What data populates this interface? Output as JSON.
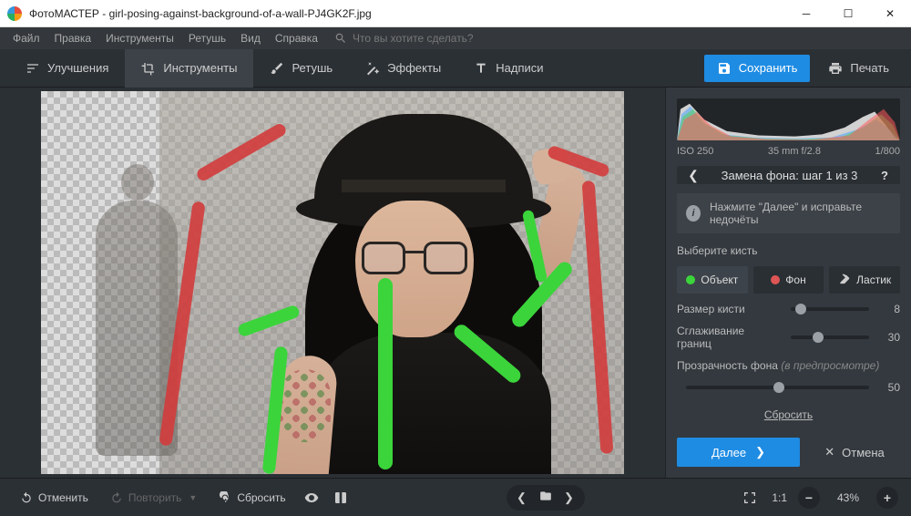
{
  "window": {
    "title": "ФотоМАСТЕР - girl-posing-against-background-of-a-wall-PJ4GK2F.jpg"
  },
  "menubar": {
    "items": [
      "Файл",
      "Правка",
      "Инструменты",
      "Ретушь",
      "Вид",
      "Справка"
    ],
    "search_placeholder": "Что вы хотите сделать?"
  },
  "toolbar": {
    "tabs": [
      {
        "label": "Улучшения"
      },
      {
        "label": "Инструменты"
      },
      {
        "label": "Ретушь"
      },
      {
        "label": "Эффекты"
      },
      {
        "label": "Надписи"
      }
    ],
    "active_tab_index": 1,
    "save_label": "Сохранить",
    "print_label": "Печать"
  },
  "histogram_meta": {
    "iso": "ISO 250",
    "lens": "35 mm f/2.8",
    "shutter": "1/800"
  },
  "panel": {
    "title": "Замена фона: шаг 1 из 3",
    "hint": "Нажмите \"Далее\" и исправьте недочёты",
    "brush_section_label": "Выберите кисть",
    "brushes": {
      "object": "Объект",
      "background": "Фон",
      "eraser": "Ластик"
    },
    "sliders": {
      "size": {
        "label": "Размер кисти",
        "value": 8
      },
      "smooth": {
        "label": "Сглаживание границ",
        "value": 30
      },
      "opacity": {
        "label": "Прозрачность фона",
        "note": "(в предпросмотре)",
        "value": 50
      }
    },
    "reset_label": "Сбросить",
    "next_label": "Далее",
    "cancel_label": "Отмена"
  },
  "bottombar": {
    "undo": "Отменить",
    "redo": "Повторить",
    "reset": "Сбросить",
    "zoom_ratio": "1:1",
    "zoom_pct": "43%"
  }
}
